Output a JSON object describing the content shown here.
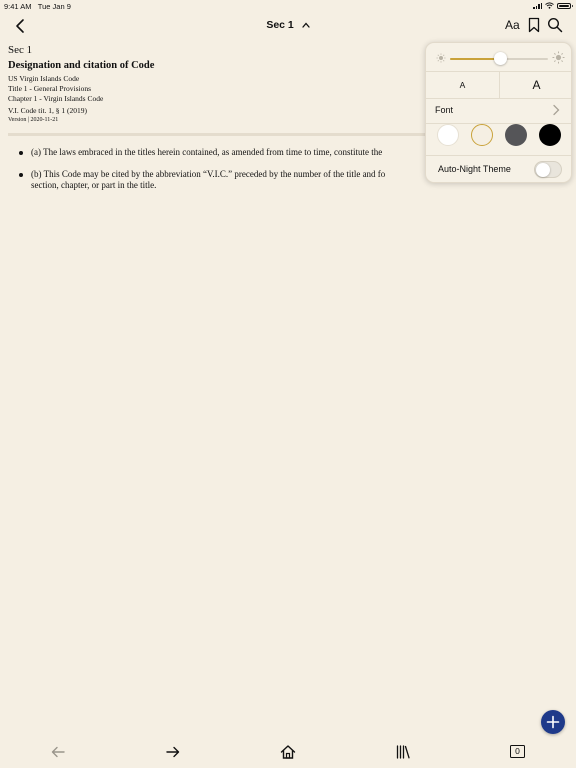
{
  "status_bar": {
    "time": "9:41 AM",
    "date": "Tue Jan 9"
  },
  "nav": {
    "title": "Sec 1",
    "text_settings_label": "Aa"
  },
  "document": {
    "section": "Sec 1",
    "heading": "Designation and citation of Code",
    "breadcrumbs": [
      "US Virgin Islands Code",
      "Title 1 - General Provisions",
      "Chapter 1 - Virgin Islands Code"
    ],
    "citation": "V.I. Code tit. 1, § 1 (2019)",
    "version": "Version | 2020-11-21",
    "paragraphs": [
      "(a) The laws embraced in the titles herein contained, as amended from time to time, constitute the",
      "(b) This Code may be cited by the abbreviation “V.I.C.” preceded by the number of the title and fo\nsection, chapter, or part in the title."
    ]
  },
  "settings_popover": {
    "brightness": 0.52,
    "font_small_label": "A",
    "font_large_label": "A",
    "font_label": "Font",
    "themes": [
      {
        "name": "white",
        "color": "#ffffff",
        "selected": false
      },
      {
        "name": "sepia",
        "color": "#f5efe3",
        "selected": true
      },
      {
        "name": "gray",
        "color": "#555558",
        "selected": false
      },
      {
        "name": "black",
        "color": "#000000",
        "selected": false
      }
    ],
    "accent_color": "#c9a23a",
    "auto_night_label": "Auto-Night Theme",
    "auto_night_enabled": false
  },
  "toolbar": {
    "open_count": "0"
  },
  "colors": {
    "background": "#f5efe3",
    "fab": "#1f3a8a"
  },
  "icons": [
    "back-chevron-icon",
    "chevron-up-icon",
    "bookmark-icon",
    "search-icon",
    "sun-small-icon",
    "sun-large-icon",
    "chevron-right-icon",
    "plus-icon",
    "arrow-left-icon",
    "arrow-right-icon",
    "home-icon",
    "library-icon"
  ]
}
